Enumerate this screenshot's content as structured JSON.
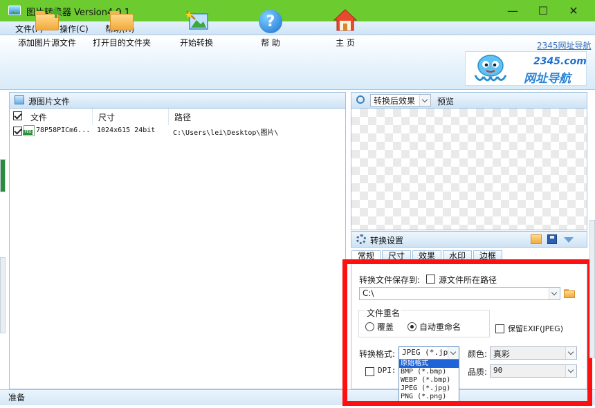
{
  "window": {
    "title": "图片转换器 Version4.9.1",
    "controls": {
      "minimize": "—",
      "maximize": "☐",
      "close": "✕"
    }
  },
  "menu": [
    {
      "label": "文件(F)"
    },
    {
      "label": "操作(C)"
    },
    {
      "label": "帮助(H)"
    }
  ],
  "toolbar": {
    "add_source": "添加图片源文件",
    "open_dest": "打开目的文件夹",
    "start": "开始转换",
    "help": "帮 助",
    "home": "主 页",
    "banner_link": "2345网址导航",
    "banner_brand": "2345.com",
    "banner_subtitle": "网址导航",
    "help_glyph": "?"
  },
  "source_panel": {
    "title": "源图片文件",
    "columns": [
      "文件",
      "尺寸",
      "路径"
    ],
    "rows": [
      {
        "checked": true,
        "badge": "JPEG",
        "file": "78P58PICm6...",
        "size": "1024x615  24bit",
        "path": "C:\\Users\\lei\\Desktop\\图片\\"
      }
    ]
  },
  "preview_panel": {
    "mode": "转换后效果",
    "label": "预览"
  },
  "settings": {
    "title": "转换设置",
    "tabs": [
      "常规",
      "尺寸",
      "效果",
      "水印",
      "边框"
    ],
    "save_to_label": "转换文件保存到:",
    "source_path_checkbox": "源文件所在路径",
    "save_path": "C:\\",
    "rename_group": "文件重名",
    "rename_options": [
      "覆盖",
      "自动重命名"
    ],
    "rename_selected": 1,
    "keep_exif": "保留EXIF(JPEG)",
    "format_label": "转换格式:",
    "format_value": "JPEG (*.jpg",
    "color_label": "颜色:",
    "color_value": "真彩",
    "dpi_label": "DPI:",
    "quality_label": "品质:",
    "quality_value": "90",
    "format_options": [
      "原始格式",
      "BMP (*.bmp)",
      "WEBP (*.bmp)",
      "JPEG (*.jpg)",
      "PNG (*.png)"
    ],
    "format_highlight": 0
  },
  "status": {
    "text": "准备"
  },
  "accent_colors": {
    "titlebar": "#6ccb2e",
    "highlight_frame": "#ff1010",
    "selection": "#1e63d8"
  }
}
